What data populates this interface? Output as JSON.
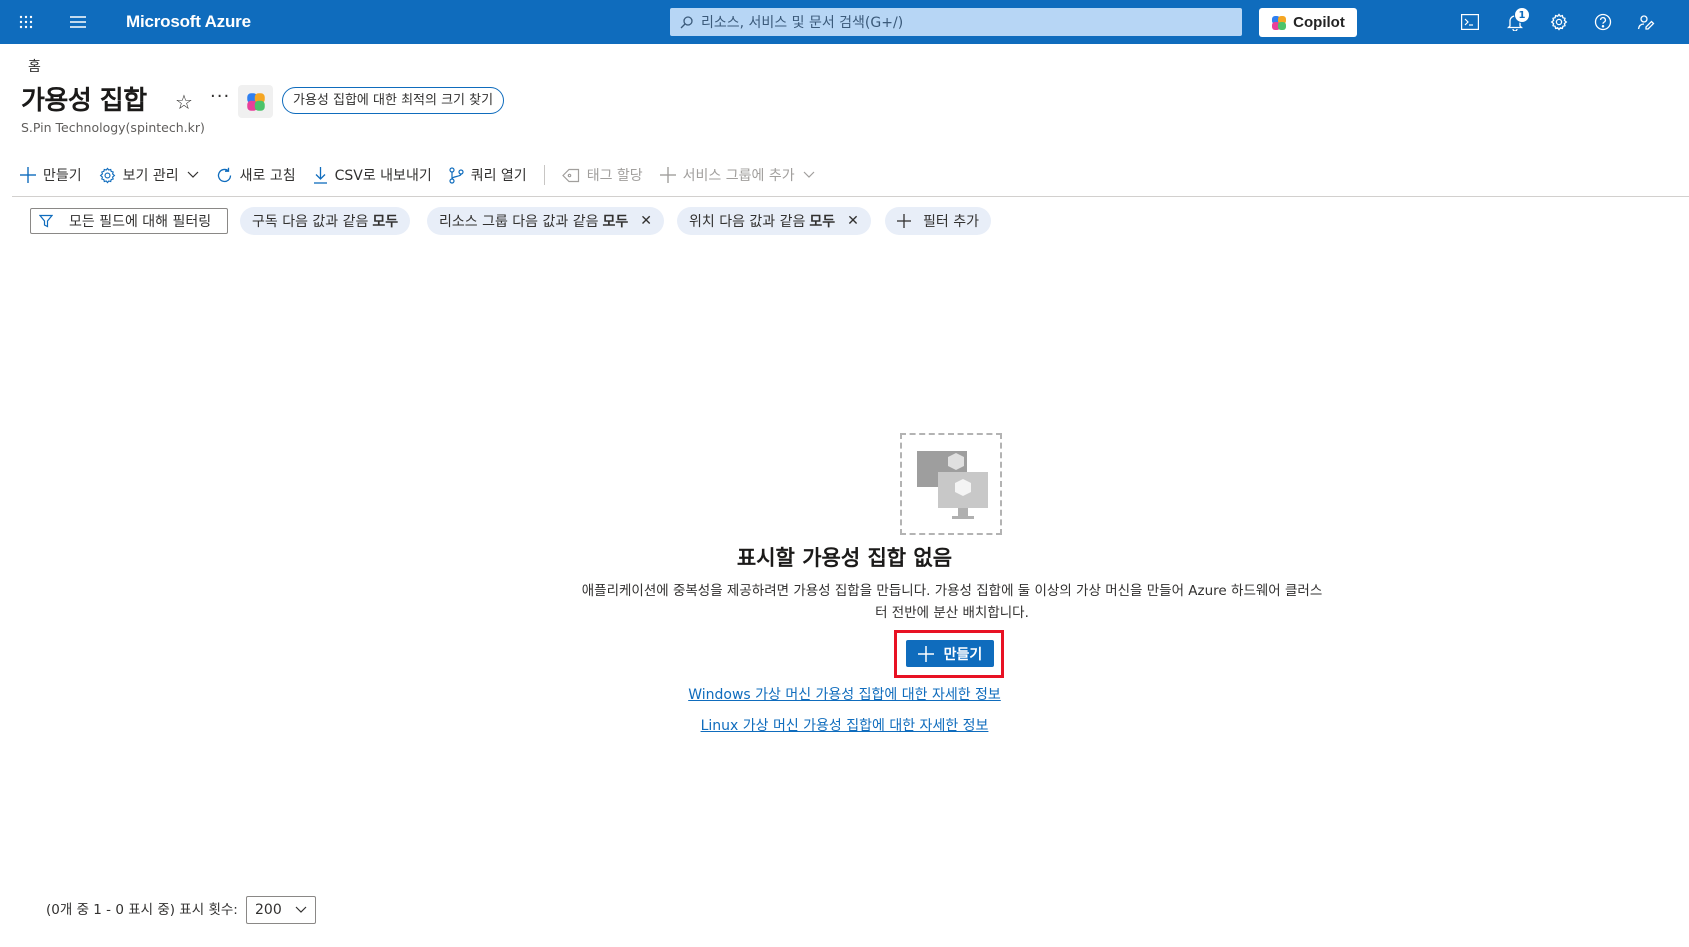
{
  "topbar": {
    "brand": "Microsoft Azure",
    "search_placeholder": "리소스, 서비스 및 문서 검색(G+/)",
    "copilot_label": "Copilot",
    "notification_count": "1"
  },
  "header": {
    "breadcrumb": "홈",
    "title": "가용성 집합",
    "find_size_label": "가용성 집합에 대한 최적의 크기 찾기",
    "subtitle": "S.Pin Technology(spintech.kr)"
  },
  "commands": {
    "create": "만들기",
    "manage_view": "보기 관리",
    "refresh": "새로 고침",
    "export_csv": "CSV로 내보내기",
    "open_query": "쿼리 열기",
    "assign_tags": "태그 할당",
    "add_to_service_group": "서비스 그룹에 추가"
  },
  "filters": {
    "placeholder": "모든 필드에 대해 필터링",
    "chips": [
      {
        "label": "구독 다음 값과 같음",
        "value": "모두"
      },
      {
        "label": "리소스 그룹 다음 값과 같음",
        "value": "모두"
      },
      {
        "label": "위치 다음 값과 같음",
        "value": "모두"
      }
    ],
    "add_filter": "필터 추가"
  },
  "empty_state": {
    "title": "표시할 가용성 집합 없음",
    "description": "애플리케이션에 중복성을 제공하려면 가용성 집합을 만듭니다. 가용성 집합에 둘 이상의 가상 머신을 만들어 Azure 하드웨어 클러스터 전반에 분산 배치합니다.",
    "create_button": "만들기",
    "windows_link": "Windows 가상 머신 가용성 집합에 대한 자세한 정보",
    "linux_link": "Linux 가상 머신 가용성 집합에 대한 자세한 정보"
  },
  "footer": {
    "pager_text": "(0개 중 1 - 0 표시 중) 표시 횟수:",
    "page_size": "200"
  },
  "colors": {
    "brand_blue": "#0f6cbd",
    "highlight_red": "#e81123",
    "chip_bg": "#e8eef8"
  }
}
